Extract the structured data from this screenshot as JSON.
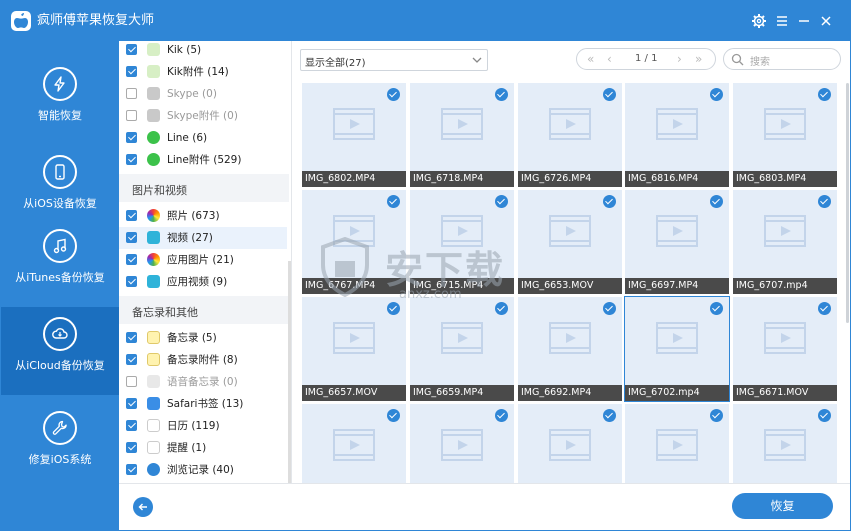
{
  "app": {
    "title": "疯师傅苹果恢复大师"
  },
  "sidebar": {
    "items": [
      {
        "label": "智能恢复",
        "icon": "lightning-icon"
      },
      {
        "label": "从iOS设备恢复",
        "icon": "phone-icon"
      },
      {
        "label": "从iTunes备份恢复",
        "icon": "music-icon"
      },
      {
        "label": "从iCloud备份恢复",
        "icon": "cloud-icon"
      },
      {
        "label": "修复iOS系统",
        "icon": "wrench-icon"
      }
    ],
    "active_index": 3
  },
  "categories": {
    "rows": [
      {
        "label": "Kik (5)",
        "checked": true
      },
      {
        "label": "Kik附件 (14)",
        "checked": true
      },
      {
        "label": "Skype (0)",
        "checked": false
      },
      {
        "label": "Skype附件 (0)",
        "checked": false
      },
      {
        "label": "Line (6)",
        "checked": true
      },
      {
        "label": "Line附件 (529)",
        "checked": true
      },
      {
        "header": "图片和视频"
      },
      {
        "label": "照片 (673)",
        "checked": true
      },
      {
        "label": "视频 (27)",
        "checked": true
      },
      {
        "label": "应用图片 (21)",
        "checked": true
      },
      {
        "label": "应用视频 (9)",
        "checked": true
      },
      {
        "header": "备忘录和其他"
      },
      {
        "label": "备忘录 (5)",
        "checked": true
      },
      {
        "label": "备忘录附件 (8)",
        "checked": true
      },
      {
        "label": "语音备忘录 (0)",
        "checked": false
      },
      {
        "label": "Safari书签 (13)",
        "checked": true
      },
      {
        "label": "日历 (119)",
        "checked": true
      },
      {
        "label": "提醒 (1)",
        "checked": true
      },
      {
        "label": "浏览记录 (40)",
        "checked": true
      }
    ]
  },
  "toolbar": {
    "filter_value": "显示全部(27)",
    "page": "1 / 1",
    "search_placeholder": "搜索"
  },
  "grid": {
    "files": [
      "IMG_6802.MP4",
      "IMG_6718.MP4",
      "IMG_6726.MP4",
      "IMG_6816.MP4",
      "IMG_6803.MP4",
      "IMG_6767.MP4",
      "IMG_6715.MP4",
      "IMG_6653.MOV",
      "IMG_6697.MP4",
      "IMG_6707.mp4",
      "IMG_6657.MOV",
      "IMG_6659.MP4",
      "IMG_6692.MP4",
      "IMG_6702.mp4",
      "IMG_6671.MOV",
      "",
      "",
      "",
      "",
      ""
    ],
    "selected_index": 13
  },
  "footer": {
    "restore_label": "恢复"
  },
  "watermark": {
    "text": "安下载",
    "sub": "anxz.com"
  },
  "colors": {
    "accent": "#2f86d6",
    "accent_dark": "#1b6fbf",
    "tile_bg": "#e4edf8"
  }
}
